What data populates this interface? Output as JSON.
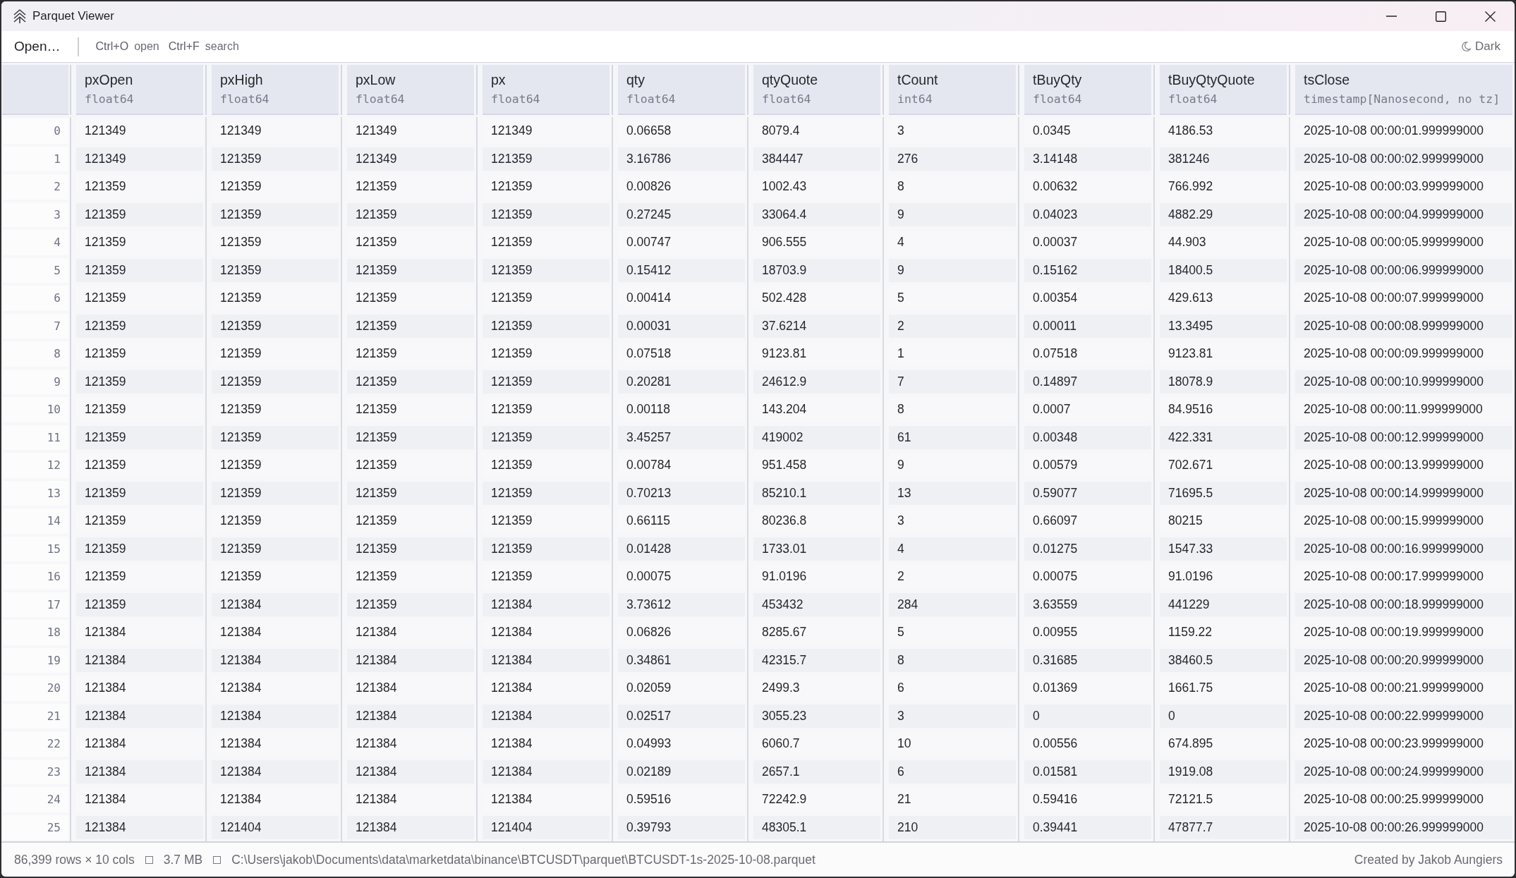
{
  "window": {
    "title": "Parquet Viewer"
  },
  "toolbar": {
    "open_button": "Open…",
    "shortcuts": [
      {
        "keys": "Ctrl+O",
        "action": "open"
      },
      {
        "keys": "Ctrl+F",
        "action": "search"
      }
    ],
    "theme_toggle": "Dark"
  },
  "table": {
    "columns": [
      {
        "name": "pxOpen",
        "type": "float64"
      },
      {
        "name": "pxHigh",
        "type": "float64"
      },
      {
        "name": "pxLow",
        "type": "float64"
      },
      {
        "name": "px",
        "type": "float64"
      },
      {
        "name": "qty",
        "type": "float64"
      },
      {
        "name": "qtyQuote",
        "type": "float64"
      },
      {
        "name": "tCount",
        "type": "int64"
      },
      {
        "name": "tBuyQty",
        "type": "float64"
      },
      {
        "name": "tBuyQtyQuote",
        "type": "float64"
      },
      {
        "name": "tsClose",
        "type": "timestamp[Nanosecond, no tz]"
      }
    ],
    "rows": [
      {
        "index": "0",
        "cells": [
          "121349",
          "121349",
          "121349",
          "121349",
          "0.06658",
          "8079.4",
          "3",
          "0.0345",
          "4186.53",
          "2025-10-08 00:00:01.999999000"
        ]
      },
      {
        "index": "1",
        "cells": [
          "121349",
          "121359",
          "121349",
          "121359",
          "3.16786",
          "384447",
          "276",
          "3.14148",
          "381246",
          "2025-10-08 00:00:02.999999000"
        ]
      },
      {
        "index": "2",
        "cells": [
          "121359",
          "121359",
          "121359",
          "121359",
          "0.00826",
          "1002.43",
          "8",
          "0.00632",
          "766.992",
          "2025-10-08 00:00:03.999999000"
        ]
      },
      {
        "index": "3",
        "cells": [
          "121359",
          "121359",
          "121359",
          "121359",
          "0.27245",
          "33064.4",
          "9",
          "0.04023",
          "4882.29",
          "2025-10-08 00:00:04.999999000"
        ]
      },
      {
        "index": "4",
        "cells": [
          "121359",
          "121359",
          "121359",
          "121359",
          "0.00747",
          "906.555",
          "4",
          "0.00037",
          "44.903",
          "2025-10-08 00:00:05.999999000"
        ]
      },
      {
        "index": "5",
        "cells": [
          "121359",
          "121359",
          "121359",
          "121359",
          "0.15412",
          "18703.9",
          "9",
          "0.15162",
          "18400.5",
          "2025-10-08 00:00:06.999999000"
        ]
      },
      {
        "index": "6",
        "cells": [
          "121359",
          "121359",
          "121359",
          "121359",
          "0.00414",
          "502.428",
          "5",
          "0.00354",
          "429.613",
          "2025-10-08 00:00:07.999999000"
        ]
      },
      {
        "index": "7",
        "cells": [
          "121359",
          "121359",
          "121359",
          "121359",
          "0.00031",
          "37.6214",
          "2",
          "0.00011",
          "13.3495",
          "2025-10-08 00:00:08.999999000"
        ]
      },
      {
        "index": "8",
        "cells": [
          "121359",
          "121359",
          "121359",
          "121359",
          "0.07518",
          "9123.81",
          "1",
          "0.07518",
          "9123.81",
          "2025-10-08 00:00:09.999999000"
        ]
      },
      {
        "index": "9",
        "cells": [
          "121359",
          "121359",
          "121359",
          "121359",
          "0.20281",
          "24612.9",
          "7",
          "0.14897",
          "18078.9",
          "2025-10-08 00:00:10.999999000"
        ]
      },
      {
        "index": "10",
        "cells": [
          "121359",
          "121359",
          "121359",
          "121359",
          "0.00118",
          "143.204",
          "8",
          "0.0007",
          "84.9516",
          "2025-10-08 00:00:11.999999000"
        ]
      },
      {
        "index": "11",
        "cells": [
          "121359",
          "121359",
          "121359",
          "121359",
          "3.45257",
          "419002",
          "61",
          "0.00348",
          "422.331",
          "2025-10-08 00:00:12.999999000"
        ]
      },
      {
        "index": "12",
        "cells": [
          "121359",
          "121359",
          "121359",
          "121359",
          "0.00784",
          "951.458",
          "9",
          "0.00579",
          "702.671",
          "2025-10-08 00:00:13.999999000"
        ]
      },
      {
        "index": "13",
        "cells": [
          "121359",
          "121359",
          "121359",
          "121359",
          "0.70213",
          "85210.1",
          "13",
          "0.59077",
          "71695.5",
          "2025-10-08 00:00:14.999999000"
        ]
      },
      {
        "index": "14",
        "cells": [
          "121359",
          "121359",
          "121359",
          "121359",
          "0.66115",
          "80236.8",
          "3",
          "0.66097",
          "80215",
          "2025-10-08 00:00:15.999999000"
        ]
      },
      {
        "index": "15",
        "cells": [
          "121359",
          "121359",
          "121359",
          "121359",
          "0.01428",
          "1733.01",
          "4",
          "0.01275",
          "1547.33",
          "2025-10-08 00:00:16.999999000"
        ]
      },
      {
        "index": "16",
        "cells": [
          "121359",
          "121359",
          "121359",
          "121359",
          "0.00075",
          "91.0196",
          "2",
          "0.00075",
          "91.0196",
          "2025-10-08 00:00:17.999999000"
        ]
      },
      {
        "index": "17",
        "cells": [
          "121359",
          "121384",
          "121359",
          "121384",
          "3.73612",
          "453432",
          "284",
          "3.63559",
          "441229",
          "2025-10-08 00:00:18.999999000"
        ]
      },
      {
        "index": "18",
        "cells": [
          "121384",
          "121384",
          "121384",
          "121384",
          "0.06826",
          "8285.67",
          "5",
          "0.00955",
          "1159.22",
          "2025-10-08 00:00:19.999999000"
        ]
      },
      {
        "index": "19",
        "cells": [
          "121384",
          "121384",
          "121384",
          "121384",
          "0.34861",
          "42315.7",
          "8",
          "0.31685",
          "38460.5",
          "2025-10-08 00:00:20.999999000"
        ]
      },
      {
        "index": "20",
        "cells": [
          "121384",
          "121384",
          "121384",
          "121384",
          "0.02059",
          "2499.3",
          "6",
          "0.01369",
          "1661.75",
          "2025-10-08 00:00:21.999999000"
        ]
      },
      {
        "index": "21",
        "cells": [
          "121384",
          "121384",
          "121384",
          "121384",
          "0.02517",
          "3055.23",
          "3",
          "0",
          "0",
          "2025-10-08 00:00:22.999999000"
        ]
      },
      {
        "index": "22",
        "cells": [
          "121384",
          "121384",
          "121384",
          "121384",
          "0.04993",
          "6060.7",
          "10",
          "0.00556",
          "674.895",
          "2025-10-08 00:00:23.999999000"
        ]
      },
      {
        "index": "23",
        "cells": [
          "121384",
          "121384",
          "121384",
          "121384",
          "0.02189",
          "2657.1",
          "6",
          "0.01581",
          "1919.08",
          "2025-10-08 00:00:24.999999000"
        ]
      },
      {
        "index": "24",
        "cells": [
          "121384",
          "121384",
          "121384",
          "121384",
          "0.59516",
          "72242.9",
          "21",
          "0.59416",
          "72121.5",
          "2025-10-08 00:00:25.999999000"
        ]
      },
      {
        "index": "25",
        "cells": [
          "121384",
          "121404",
          "121384",
          "121404",
          "0.39793",
          "48305.1",
          "210",
          "0.39441",
          "47877.7",
          "2025-10-08 00:00:26.999999000"
        ]
      }
    ]
  },
  "status_bar": {
    "shape": "86,399 rows × 10 cols",
    "size": "3.7 MB",
    "path": "C:\\Users\\jakob\\Documents\\data\\marketdata\\binance\\BTCUSDT\\parquet\\BTCUSDT-1s-2025-10-08.parquet",
    "credit": "Created by Jakob Aungiers"
  }
}
